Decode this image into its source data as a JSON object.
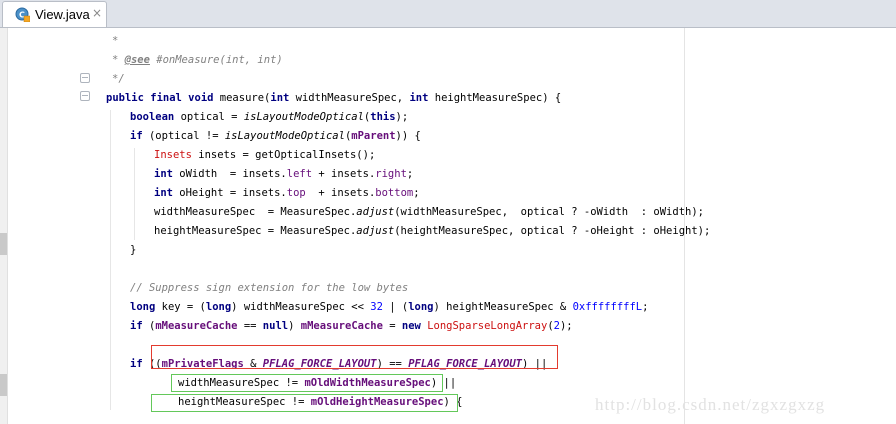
{
  "tab": {
    "label": "View.java",
    "close": "×",
    "icon": "java-class-icon"
  },
  "code": {
    "l1": "*",
    "l2_star": "* ",
    "l2_tag": "@see",
    "l2_ref": " #onMeasure",
    "l2_args": "(int, int)",
    "l3": "*/",
    "l4_kw": "public final void",
    "l4_a": " measure(",
    "l4_int1": "int",
    "l4_b": " widthMeasureSpec, ",
    "l4_int2": "int",
    "l4_c": " heightMeasureSpec) {",
    "l5_kw": "boolean",
    "l5_a": " optical = ",
    "l5_call": "isLayoutModeOptical",
    "l5_b": "(",
    "l5_this": "this",
    "l5_c": ");",
    "l6_kw": "if",
    "l6_a": " (optical != ",
    "l6_call": "isLayoutModeOptical",
    "l6_b": "(",
    "l6_fld": "mParent",
    "l6_c": ")) {",
    "l7_type": "Insets",
    "l7_a": " insets = getOpticalInsets();",
    "l8_kw": "int",
    "l8_a": " oWidth  = insets.",
    "l8_f1": "left",
    "l8_b": " + insets.",
    "l8_f2": "right",
    "l8_c": ";",
    "l9_kw": "int",
    "l9_a": " oHeight = insets.",
    "l9_f1": "top",
    "l9_b": "  + insets.",
    "l9_f2": "bottom",
    "l9_c": ";",
    "l10_a": "widthMeasureSpec  = MeasureSpec.",
    "l10_call": "adjust",
    "l10_b": "(widthMeasureSpec,  optical ? -oWidth  : oWidth);",
    "l11_a": "heightMeasureSpec = MeasureSpec.",
    "l11_call": "adjust",
    "l11_b": "(heightMeasureSpec, optical ? -oHeight : oHeight);",
    "l12": "}",
    "l13": "// Suppress sign extension for the low bytes",
    "l14_kw": "long",
    "l14_a": " key = (",
    "l14_kw2": "long",
    "l14_b": ") widthMeasureSpec << ",
    "l14_n1": "32",
    "l14_c": " | (",
    "l14_kw3": "long",
    "l14_d": ") heightMeasureSpec & ",
    "l14_n2": "0xffffffffL",
    "l14_e": ";",
    "l15_kw": "if",
    "l15_a": " (",
    "l15_f1": "mMeasureCache",
    "l15_b": " == ",
    "l15_null": "null",
    "l15_c": ") ",
    "l15_f2": "mMeasureCache",
    "l15_d": " = ",
    "l15_new": "new",
    "l15_type": " LongSparseLongArray",
    "l15_e": "(",
    "l15_n": "2",
    "l15_f": ");",
    "l16_kw": "if",
    "l16_a": " ((",
    "l16_f1": "mPrivateFlags",
    "l16_b": " & ",
    "l16_sf1": "PFLAG_FORCE_LAYOUT",
    "l16_c": ") == ",
    "l16_sf2": "PFLAG_FORCE_LAYOUT",
    "l16_d": ") ||",
    "l17_a": "widthMeasureSpec != ",
    "l17_f": "mOldWidthMeasureSpec",
    "l17_b": ") ||",
    "l18_a": "heightMeasureSpec != ",
    "l18_f": "mOldHeightMeasureSpec",
    "l18_b": ") {"
  },
  "watermark": "http://blog.csdn.net/zgxzgxzg",
  "colors": {
    "keyword": "#000080",
    "comment": "#808080",
    "field": "#660e7a",
    "number": "#0000ff",
    "type": "#cc1111",
    "annotation_red": "#e33b2e",
    "annotation_green": "#63c85a"
  }
}
